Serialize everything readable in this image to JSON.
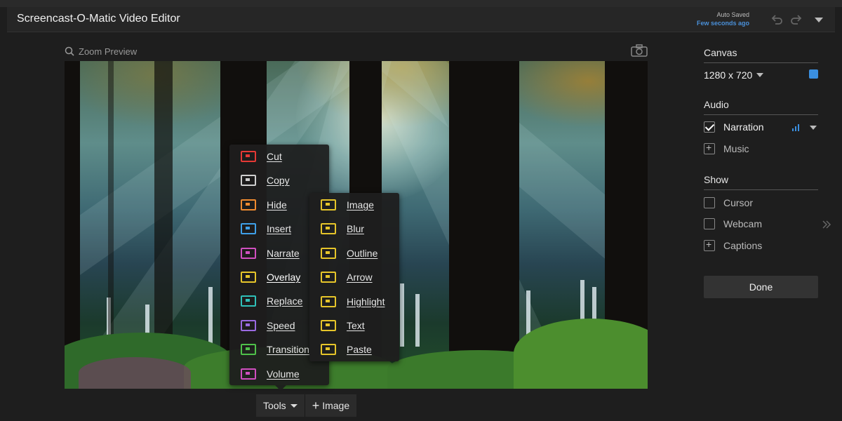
{
  "window": {
    "title": "Screencast-O-Matic Video Editor",
    "autosave_label": "Auto Saved",
    "autosave_time": "Few seconds ago"
  },
  "preview": {
    "zoom_label": "Zoom Preview"
  },
  "context_menu": {
    "items": [
      {
        "label": "Cut",
        "icon": "cut-icon",
        "color": "#e53935"
      },
      {
        "label": "Copy",
        "icon": "copy-icon",
        "color": "#cfcfcf"
      },
      {
        "label": "Hide",
        "icon": "hide-icon",
        "color": "#ef8a2f"
      },
      {
        "label": "Insert",
        "icon": "insert-icon",
        "color": "#3fa0e8"
      },
      {
        "label": "Narrate",
        "icon": "narrate-icon",
        "color": "#d04fc0"
      },
      {
        "label": "Overlay",
        "icon": "overlay-icon",
        "color": "#e6c52a"
      },
      {
        "label": "Replace",
        "icon": "replace-icon",
        "color": "#2fc0b8"
      },
      {
        "label": "Speed",
        "icon": "speed-icon",
        "color": "#9a6ae0"
      },
      {
        "label": "Transition",
        "icon": "transition-icon",
        "color": "#4fc04a"
      },
      {
        "label": "Volume",
        "icon": "volume-icon",
        "color": "#d04fc0"
      }
    ],
    "active_item": "Overlay"
  },
  "overlay_submenu": {
    "items": [
      {
        "label": "Image",
        "icon": "image-icon",
        "color": "#e6c52a"
      },
      {
        "label": "Blur",
        "icon": "blur-icon",
        "color": "#e6c52a"
      },
      {
        "label": "Outline",
        "icon": "outline-icon",
        "color": "#e6c52a"
      },
      {
        "label": "Arrow",
        "icon": "arrow-icon",
        "color": "#e6c52a"
      },
      {
        "label": "Highlight",
        "icon": "highlight-icon",
        "color": "#e6c52a"
      },
      {
        "label": "Text",
        "icon": "text-icon",
        "color": "#e6c52a"
      },
      {
        "label": "Paste",
        "icon": "paste-icon",
        "color": "#e6c52a"
      }
    ]
  },
  "bottom_bar": {
    "tools_label": "Tools",
    "add_image_label": "Image"
  },
  "side_panel": {
    "canvas": {
      "heading": "Canvas",
      "size": "1280 x 720",
      "color": "#3a8fe0"
    },
    "audio": {
      "heading": "Audio",
      "narration_label": "Narration",
      "narration_checked": true,
      "music_label": "Music"
    },
    "show": {
      "heading": "Show",
      "cursor_label": "Cursor",
      "webcam_label": "Webcam",
      "captions_label": "Captions"
    },
    "done_label": "Done"
  }
}
